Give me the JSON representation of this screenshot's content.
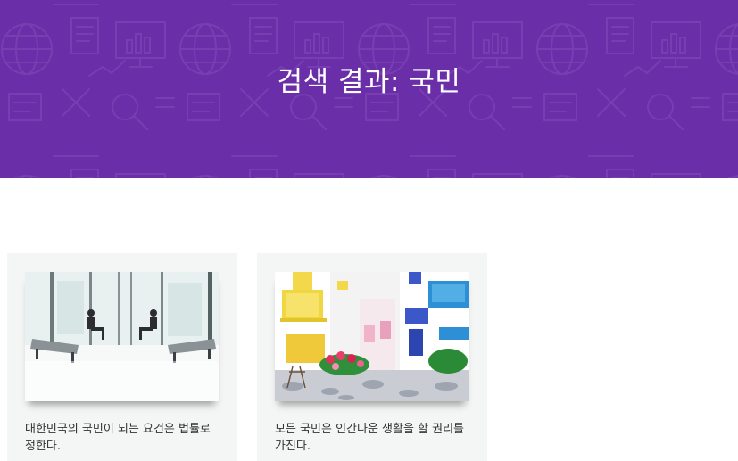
{
  "hero": {
    "title": "검색 결과: 국민",
    "background_color": "#6a2ea8"
  },
  "results": [
    {
      "image_subject": "airport-waiting-lounge-photo",
      "text": "대한민국의 국민이 되는 요건은 법률로 정한다."
    },
    {
      "image_subject": "colorful-village-street-photo",
      "text": "모든 국민은 인간다운 생활을 할 권리를 가진다."
    }
  ]
}
